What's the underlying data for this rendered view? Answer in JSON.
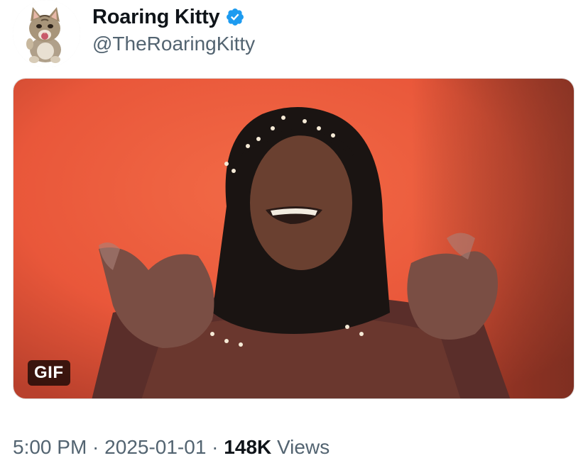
{
  "author": {
    "display_name": "Roaring Kitty",
    "handle": "@TheRoaringKitty",
    "verified": true,
    "avatar_icon": "kitten-avatar",
    "verified_color": "#1d9bf0"
  },
  "media": {
    "type": "gif",
    "badge_label": "GIF"
  },
  "meta": {
    "time": "5:00 PM",
    "separator": " · ",
    "date": "2025-01-01",
    "view_count": "148K",
    "views_label": " Views"
  },
  "colors": {
    "text_primary": "#0f1419",
    "text_secondary": "#536471",
    "background": "#ffffff"
  }
}
